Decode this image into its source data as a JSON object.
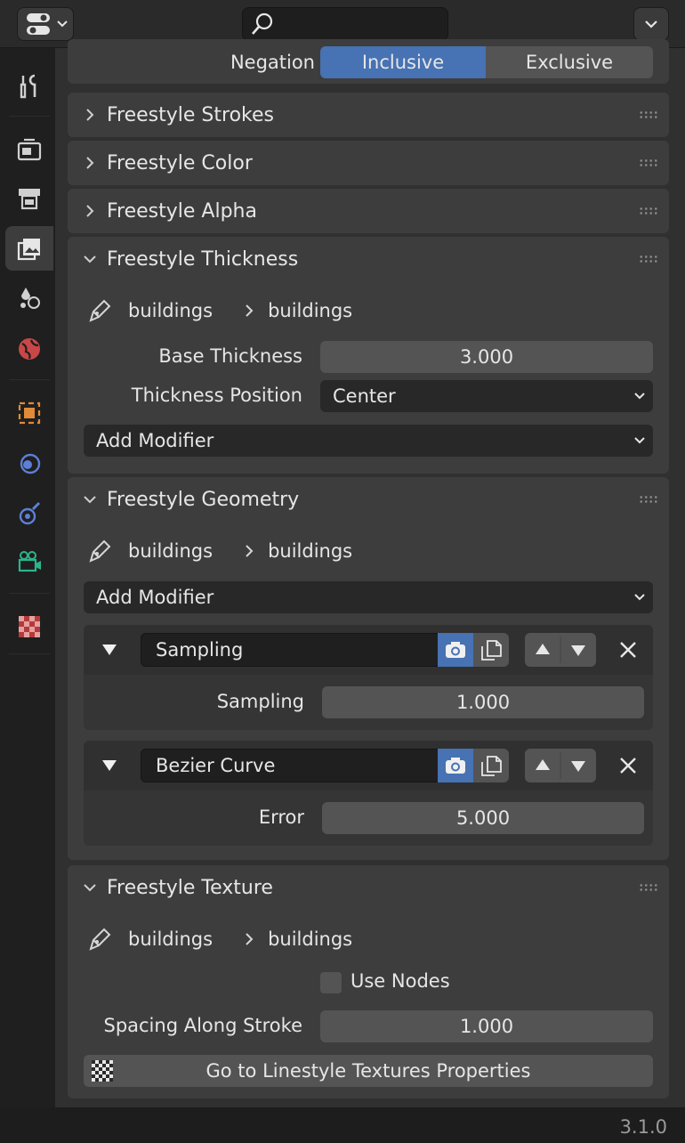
{
  "header": {
    "search_placeholder": ""
  },
  "tabs": [
    {
      "icon": "tool-icon"
    },
    {
      "icon": "render-icon"
    },
    {
      "icon": "output-icon"
    },
    {
      "icon": "view-layer-icon",
      "active": true
    },
    {
      "icon": "scene-icon"
    },
    {
      "icon": "world-icon"
    },
    {
      "icon": "object-icon"
    },
    {
      "icon": "modifiers-icon"
    },
    {
      "icon": "physics-icon"
    },
    {
      "icon": "object-data-camera-icon"
    },
    {
      "icon": "texture-icon"
    }
  ],
  "negation": {
    "label": "Negation",
    "opt_inclusive": "Inclusive",
    "opt_exclusive": "Exclusive",
    "selected": "Inclusive"
  },
  "panels": {
    "strokes": "Freestyle Strokes",
    "color": "Freestyle Color",
    "alpha": "Freestyle Alpha",
    "thickness": "Freestyle Thickness",
    "geometry": "Freestyle Geometry",
    "texture": "Freestyle Texture"
  },
  "breadcrumb": {
    "from": "buildings",
    "to": "buildings"
  },
  "thickness": {
    "base_label": "Base Thickness",
    "base_value": "3.000",
    "position_label": "Thickness Position",
    "position_value": "Center",
    "add_modifier": "Add Modifier"
  },
  "geometry": {
    "add_modifier": "Add Modifier",
    "modifiers": [
      {
        "name": "Sampling",
        "prop_label": "Sampling",
        "prop_value": "1.000"
      },
      {
        "name": "Bezier Curve",
        "prop_label": "Error",
        "prop_value": "5.000"
      }
    ]
  },
  "texture": {
    "use_nodes_label": "Use Nodes",
    "use_nodes": false,
    "spacing_label": "Spacing Along Stroke",
    "spacing_value": "1.000",
    "goto_button": "Go to Linestyle Textures Properties"
  },
  "version": "3.1.0"
}
